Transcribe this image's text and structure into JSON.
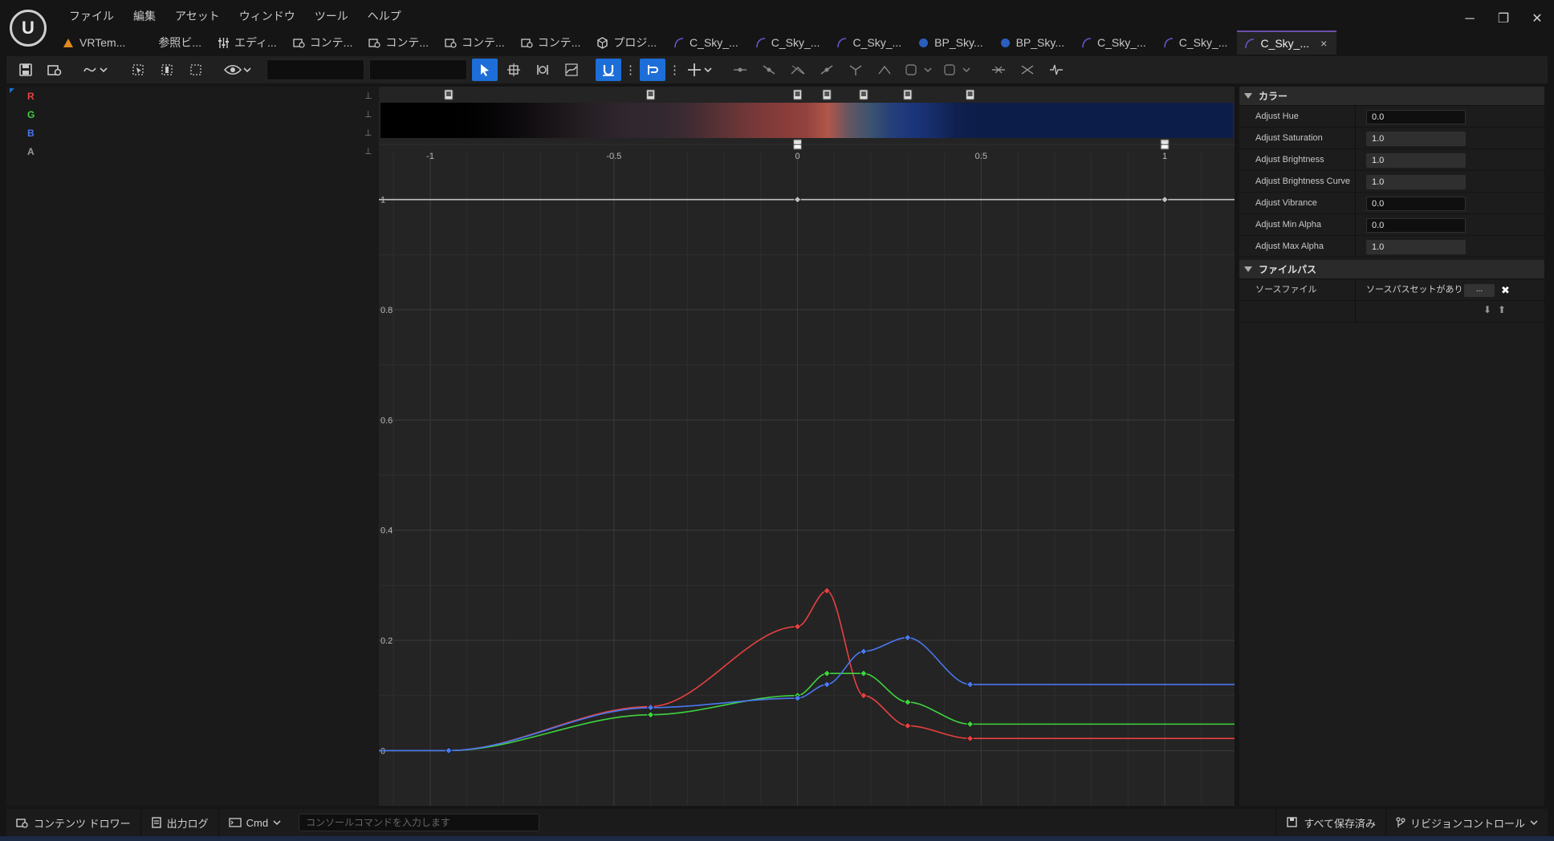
{
  "menu": [
    "ファイル",
    "編集",
    "アセット",
    "ウィンドウ",
    "ツール",
    "ヘルプ"
  ],
  "window_controls": [
    "─",
    "❐",
    "✕"
  ],
  "tabs": [
    {
      "label": "VRTem...",
      "icon": "map-icon"
    },
    {
      "label": "参照ビ...",
      "icon": "reference-icon"
    },
    {
      "label": "エディ...",
      "icon": "sliders-icon"
    },
    {
      "label": "コンテ...",
      "icon": "content-icon"
    },
    {
      "label": "コンテ...",
      "icon": "content-icon"
    },
    {
      "label": "コンテ...",
      "icon": "content-icon"
    },
    {
      "label": "コンテ...",
      "icon": "content-icon"
    },
    {
      "label": "プロジ...",
      "icon": "project-icon"
    },
    {
      "label": "C_Sky_...",
      "icon": "curve-icon"
    },
    {
      "label": "C_Sky_...",
      "icon": "curve-icon"
    },
    {
      "label": "C_Sky_...",
      "icon": "curve-icon"
    },
    {
      "label": "BP_Sky...",
      "icon": "blueprint-icon"
    },
    {
      "label": "BP_Sky...",
      "icon": "blueprint-icon"
    },
    {
      "label": "C_Sky_...",
      "icon": "curve-icon"
    },
    {
      "label": "C_Sky_...",
      "icon": "curve-icon"
    },
    {
      "label": "C_Sky_...",
      "icon": "curve-icon",
      "active": true
    }
  ],
  "tab_close": "×",
  "channels": [
    {
      "label": "R",
      "color": "#e84040"
    },
    {
      "label": "G",
      "color": "#3fd33f"
    },
    {
      "label": "B",
      "color": "#4a78f0"
    },
    {
      "label": "A",
      "color": "#9a9a9a"
    }
  ],
  "curve": {
    "x_ticks": [
      -1,
      -0.5,
      0,
      0.5,
      1
    ],
    "x_tick_labels": [
      "-1",
      "-0.5",
      "0",
      "0.5",
      "1"
    ],
    "y_ticks": [
      0,
      0.2,
      0.4,
      0.6,
      0.8,
      1
    ],
    "y_tick_labels": [
      "0",
      "0.2",
      "0.4",
      "0.6",
      "0.8",
      "1"
    ],
    "xlim": [
      -1.14,
      1.19
    ],
    "ylim": [
      -0.1,
      1.1
    ],
    "series": [
      {
        "channel": "R",
        "color": "#e84040",
        "points": [
          [
            -0.95,
            0
          ],
          [
            -0.4,
            0.08
          ],
          [
            0,
            0.225
          ],
          [
            0.08,
            0.29
          ],
          [
            0.18,
            0.1
          ],
          [
            0.3,
            0.045
          ],
          [
            0.47,
            0.022
          ]
        ],
        "tail": 0.022
      },
      {
        "channel": "G",
        "color": "#3fd33f",
        "points": [
          [
            -0.95,
            0
          ],
          [
            -0.4,
            0.065
          ],
          [
            0,
            0.1
          ],
          [
            0.08,
            0.14
          ],
          [
            0.18,
            0.14
          ],
          [
            0.3,
            0.088
          ],
          [
            0.47,
            0.048
          ]
        ],
        "tail": 0.048
      },
      {
        "channel": "B",
        "color": "#4a78f0",
        "points": [
          [
            -0.95,
            0
          ],
          [
            -0.4,
            0.078
          ],
          [
            0,
            0.095
          ],
          [
            0.08,
            0.12
          ],
          [
            0.18,
            0.18
          ],
          [
            0.3,
            0.205
          ],
          [
            0.47,
            0.12
          ]
        ],
        "tail": 0.12
      },
      {
        "channel": "A",
        "color": "#c0c0c0",
        "points": [
          [
            0,
            1
          ],
          [
            1,
            1
          ]
        ],
        "tail": 1
      }
    ],
    "color_stops_top": [
      -0.95,
      -0.4,
      0,
      0.08,
      0.18,
      0.3,
      0.47
    ],
    "color_stops_bottom": [
      0,
      1
    ]
  },
  "details": {
    "section_color": "カラー",
    "properties": [
      {
        "label": "Adjust Hue",
        "value": "0.0"
      },
      {
        "label": "Adjust Saturation",
        "value": "1.0"
      },
      {
        "label": "Adjust Brightness",
        "value": "1.0"
      },
      {
        "label": "Adjust Brightness Curve",
        "value": "1.0"
      },
      {
        "label": "Adjust Vibrance",
        "value": "0.0"
      },
      {
        "label": "Adjust Min Alpha",
        "value": "0.0"
      },
      {
        "label": "Adjust Max Alpha",
        "value": "1.0"
      }
    ],
    "section_filepath": "ファイルパス",
    "source_file_label": "ソースファイル",
    "source_file_value": "ソースパスセットがありま",
    "browse_button": "...",
    "clear_icon": "✖"
  },
  "status": {
    "content_drawer": "コンテンツ ドロワー",
    "output_log": "出力ログ",
    "cmd": "Cmd",
    "console_placeholder": "コンソールコマンドを入力します",
    "save_all": "すべて保存済み",
    "revision_control": "リビジョンコントロール"
  }
}
